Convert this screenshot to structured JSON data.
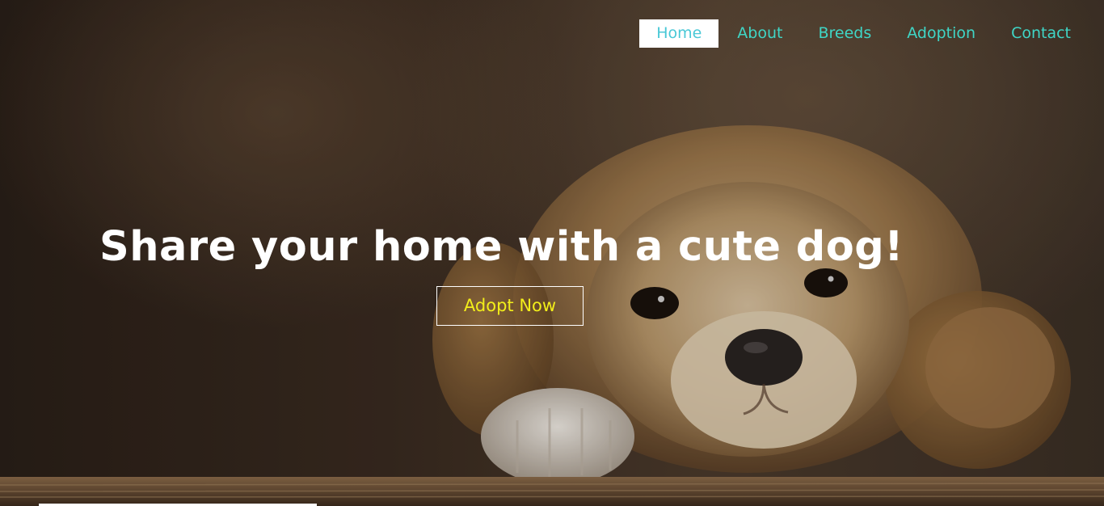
{
  "nav": {
    "items": [
      {
        "label": "Home",
        "active": true
      },
      {
        "label": "About",
        "active": false
      },
      {
        "label": "Breeds",
        "active": false
      },
      {
        "label": "Adoption",
        "active": false
      },
      {
        "label": "Contact",
        "active": false
      }
    ]
  },
  "hero": {
    "headline": "Share your home with a cute dog!",
    "cta_label": "Adopt Now",
    "image": "golden-retriever-puppy-photo"
  },
  "colors": {
    "nav_link": "#3fd6c6",
    "nav_active_bg": "#ffffff",
    "headline": "#ffffff",
    "cta_text": "#f2ee1a",
    "cta_border": "#ffffff"
  }
}
